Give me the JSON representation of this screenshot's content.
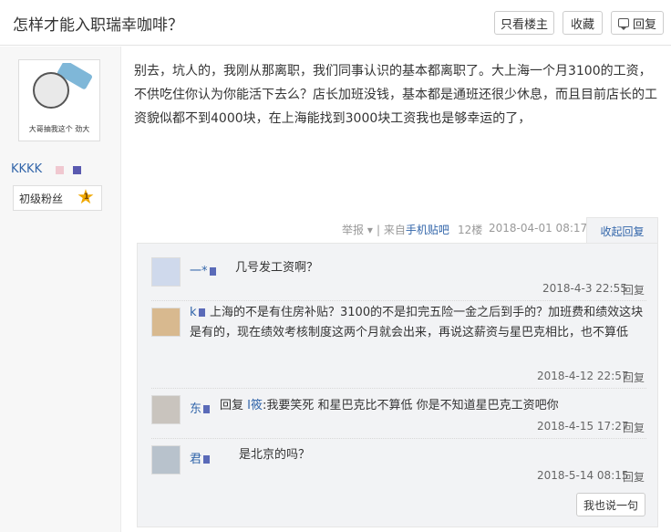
{
  "header": {
    "title": "怎样才能入职瑞幸咖啡？",
    "only_op_label": "只看楼主",
    "favorite_label": "收藏",
    "reply_label": "回复"
  },
  "user": {
    "avatar_caption": "大哥抽我这个 劲大",
    "username": "KKKK",
    "level_label": "初级粉丝",
    "level_number": "1"
  },
  "post": {
    "content": "别去，坑人的，我刚从那离职，我们同事认识的基本都离职了。大上海一个月3100的工资，不供吃住你认为你能活下去么？店长加班没钱，基本都是通班还很少休息，而且目前店长的工资貌似都不到4000块，在上海能找到3000块工资我也是够幸运的了，",
    "report_label": "举报",
    "source_prefix": "| 来自",
    "source_app": "手机贴吧",
    "floor": "12楼",
    "time": "2018-04-01 08:17",
    "collapse_label": "收起回复"
  },
  "replies": [
    {
      "name": "一*",
      "text": "几号发工资啊？",
      "time": "2018-4-3 22:55",
      "reply_label": "回复"
    },
    {
      "name": "k",
      "text": "上海的不是有住房补贴？3100的不是扣完五险一金之后到手的？加班费和绩效这块是有的，现在绩效考核制度这两个月就会出来，再说这薪资与星巴克相比，也不算低",
      "time": "2018-4-12 22:57",
      "reply_label": "回复"
    },
    {
      "name": "东",
      "reply_prefix": "回复",
      "reply_target": "I筱",
      "text": ":我要笑死 和星巴克比不算低 你是不知道星巴克工资吧你",
      "time": "2018-4-15 17:27",
      "reply_label": "回复"
    },
    {
      "name": "君",
      "text": "是北京的吗？",
      "time": "2018-5-14 08:15",
      "reply_label": "回复"
    }
  ],
  "say_label": "我也说一句",
  "colors": {
    "link": "#3366aa",
    "reply_bg": "#f2f3f5",
    "star": "#f0a800"
  }
}
